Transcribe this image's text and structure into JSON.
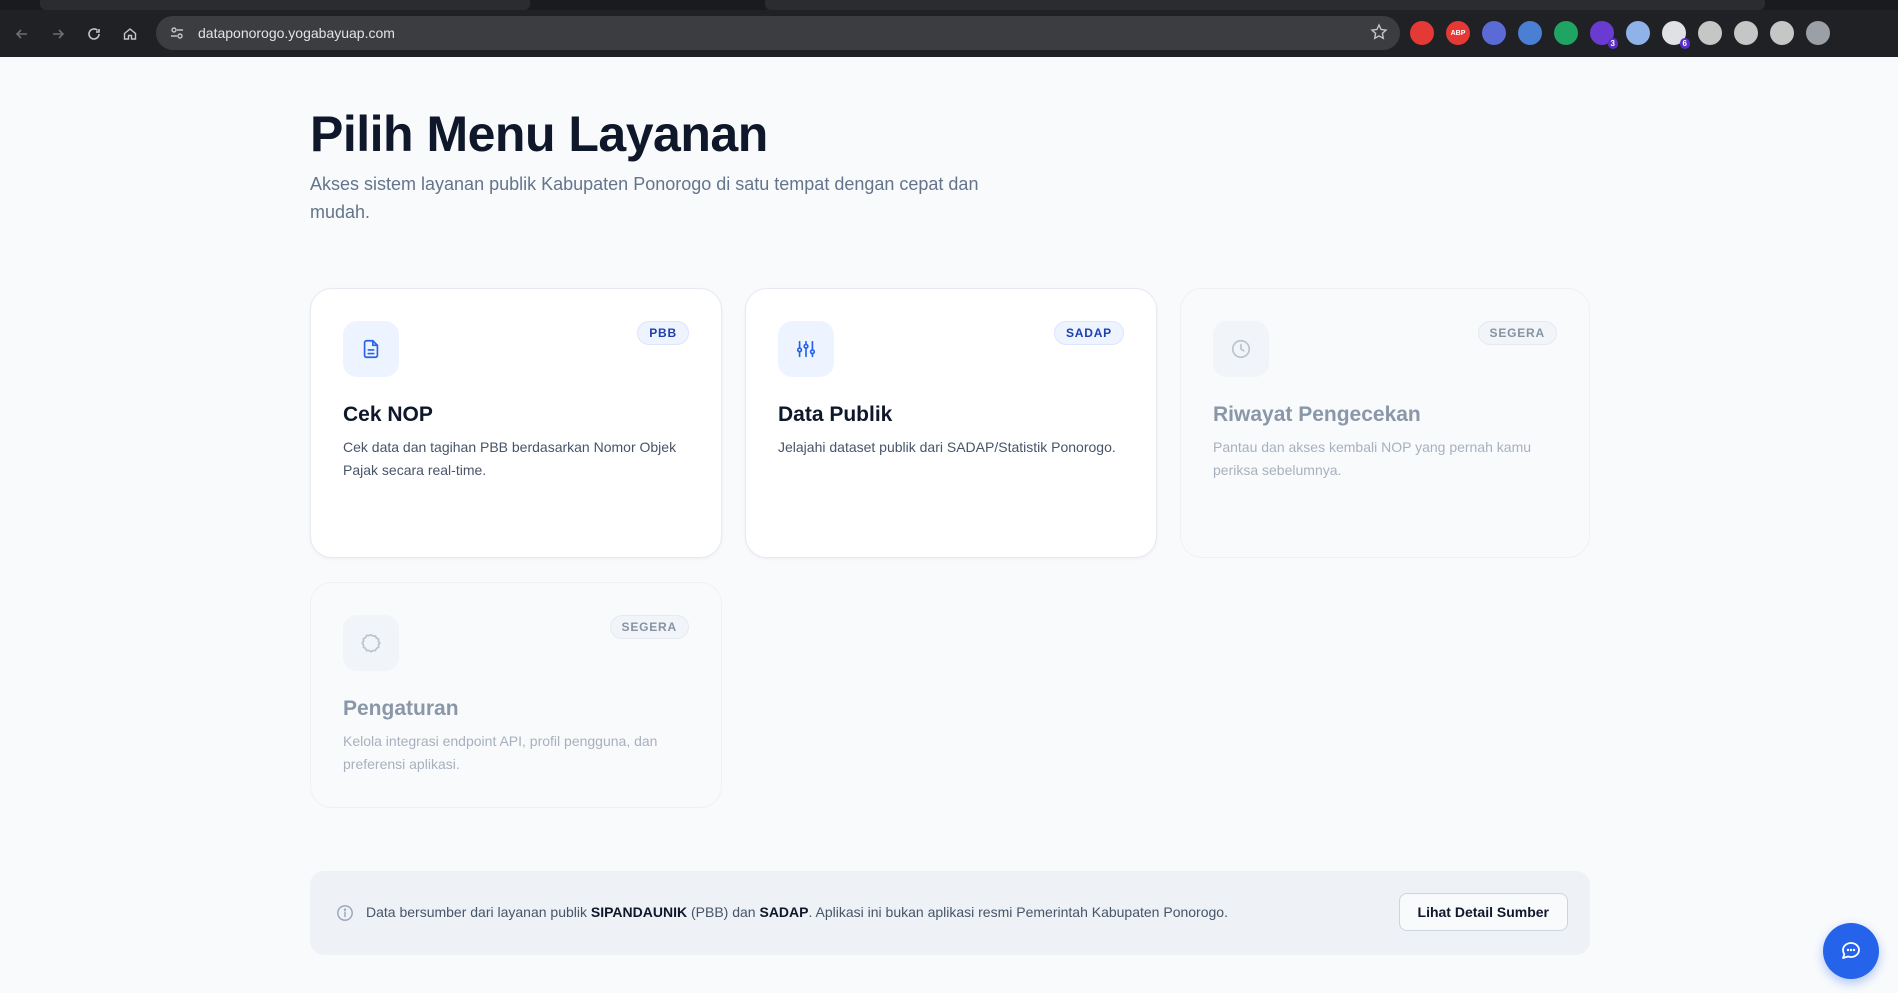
{
  "browser": {
    "url": "dataponorogo.yogabayuap.com",
    "extensions": [
      {
        "name": "red-shield-extension-icon",
        "color": "#e53935",
        "label": ""
      },
      {
        "name": "abp-extension-icon",
        "color": "#e53935",
        "label": "ABP"
      },
      {
        "name": "diamond-extension-icon",
        "color": "#5b6bd6",
        "label": ""
      },
      {
        "name": "bookmark-extension-icon",
        "color": "#4a7fd4",
        "label": ""
      },
      {
        "name": "eye-extension-icon",
        "color": "#1fa463",
        "label": ""
      },
      {
        "name": "purple-extension-icon",
        "color": "#6a3bd1",
        "label": "",
        "badge": "3"
      },
      {
        "name": "screen-extension-icon",
        "color": "#8fb3e8",
        "label": ""
      },
      {
        "name": "home-extension-icon",
        "color": "#dfe1e5",
        "label": "",
        "badge": "6"
      },
      {
        "name": "puzzle-extension-icon",
        "color": "#c4c7c5",
        "label": ""
      },
      {
        "name": "find-extension-icon",
        "color": "#c4c7c5",
        "label": ""
      },
      {
        "name": "playlist-extension-icon",
        "color": "#c4c7c5",
        "label": ""
      },
      {
        "name": "profile-avatar-icon",
        "color": "#9aa0a6",
        "label": ""
      }
    ]
  },
  "page": {
    "title": "Pilih Menu Layanan",
    "subtitle": "Akses sistem layanan publik Kabupaten Ponorogo di satu tempat dengan cepat dan mudah."
  },
  "cards": [
    {
      "title": "Cek NOP",
      "badge": "PBB",
      "desc": "Cek data dan tagihan PBB berdasarkan Nomor Objek Pajak secara real-time.",
      "icon": "document-icon"
    },
    {
      "title": "Data Publik",
      "badge": "SADAP",
      "desc": "Jelajahi dataset publik dari SADAP/Statistik Ponorogo.",
      "icon": "sliders-icon"
    },
    {
      "title": "Riwayat Pengecekan",
      "badge": "SEGERA",
      "desc": "Pantau dan akses kembali NOP yang pernah kamu periksa sebelumnya.",
      "icon": "clock-icon"
    },
    {
      "title": "Pengaturan",
      "badge": "SEGERA",
      "desc": "Kelola integrasi endpoint API, profil pengguna, dan preferensi aplikasi.",
      "icon": "gear-icon"
    }
  ],
  "footer": {
    "note_prefix": "Data bersumber dari layanan publik ",
    "source1": "SIPANDAUNIK",
    "note_mid1": " (PBB) dan ",
    "source2": "SADAP",
    "note_suffix": ". Aplikasi ini bukan aplikasi resmi Pemerintah Kabupaten Ponorogo.",
    "button_label": "Lihat Detail Sumber"
  },
  "colors": {
    "accent": "#2563eb",
    "title": "#0f172a",
    "muted": "#64748b"
  }
}
